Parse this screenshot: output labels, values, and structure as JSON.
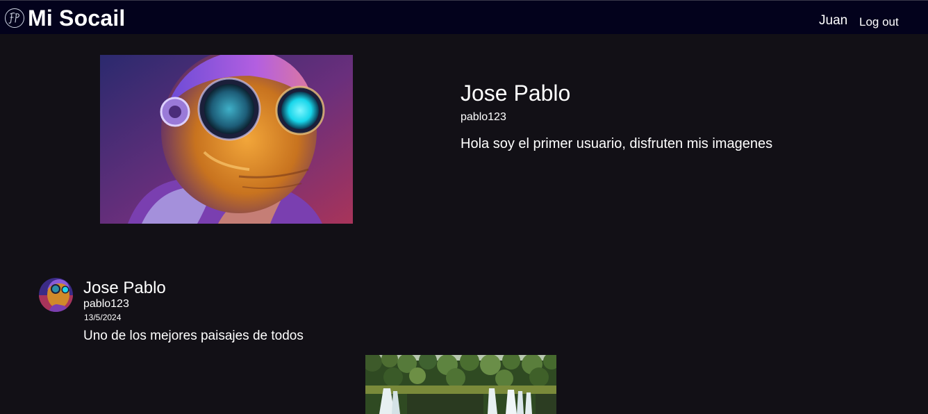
{
  "navbar": {
    "brand_name": "Mi Socail",
    "logo_icon": "fp-monogram-icon",
    "user_name": "Juan",
    "logout_label": "Log out"
  },
  "profile": {
    "name": "Jose Pablo",
    "username": "pablo123",
    "bio": "Hola soy el primer usuario, disfruten mis imagenes",
    "image_icon": "robot-portrait-image"
  },
  "post": {
    "author": "Jose Pablo",
    "username": "pablo123",
    "date": "13/5/2024",
    "text": "Uno de los mejores paisajes de todos",
    "image_icon": "waterfall-landscape-image"
  },
  "colors": {
    "page_background": "#121016",
    "navbar_background": "#03021c",
    "text": "#ffffff"
  }
}
